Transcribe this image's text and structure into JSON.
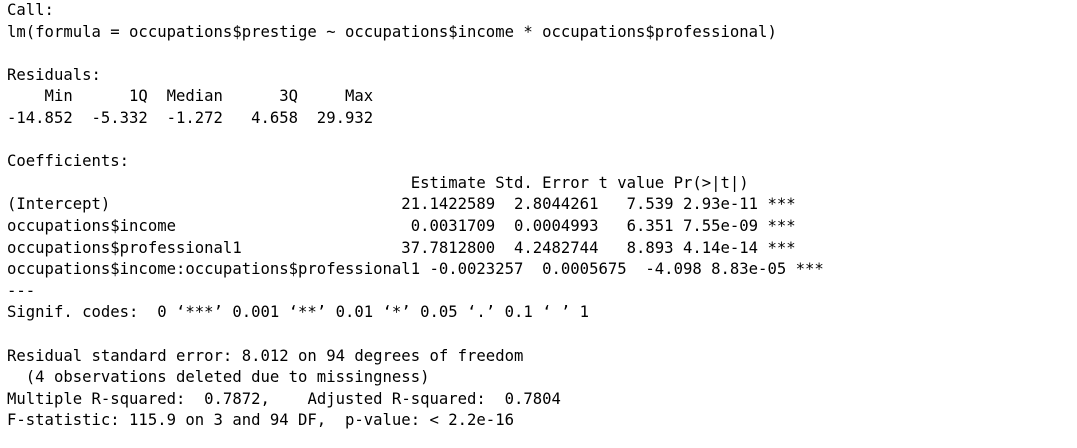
{
  "console_output": {
    "call_header": "Call:",
    "call_formula": "lm(formula = occupations$prestige ~ occupations$income * occupations$professional)",
    "residuals_header": "Residuals:",
    "residuals_labels": "    Min      1Q  Median      3Q     Max ",
    "residuals_values": "-14.852  -5.332  -1.272   4.658  29.932 ",
    "coefficients_header": "Coefficients:",
    "coef_column_header": "                                           Estimate Std. Error t value Pr(>|t|)    ",
    "coef_rows": [
      "(Intercept)                               21.1422589  2.8044261   7.539 2.93e-11 ***",
      "occupations$income                         0.0031709  0.0004993   6.351 7.55e-09 ***",
      "occupations$professional1                 37.7812800  4.2482744   8.893 4.14e-14 ***",
      "occupations$income:occupations$professional1 -0.0023257  0.0005675  -4.098 8.83e-05 ***"
    ],
    "separator": "---",
    "signif_codes": "Signif. codes:  0 ‘***’ 0.001 ‘**’ 0.01 ‘*’ 0.05 ‘.’ 0.1 ‘ ’ 1",
    "residual_se": "Residual standard error: 8.012 on 94 degrees of freedom",
    "missingness_note": "  (4 observations deleted due to missingness)",
    "r_squared": "Multiple R-squared:  0.7872,\tAdjusted R-squared:  0.7804 ",
    "f_statistic": "F-statistic: 115.9 on 3 and 94 DF,  p-value: < 2.2e-16"
  }
}
